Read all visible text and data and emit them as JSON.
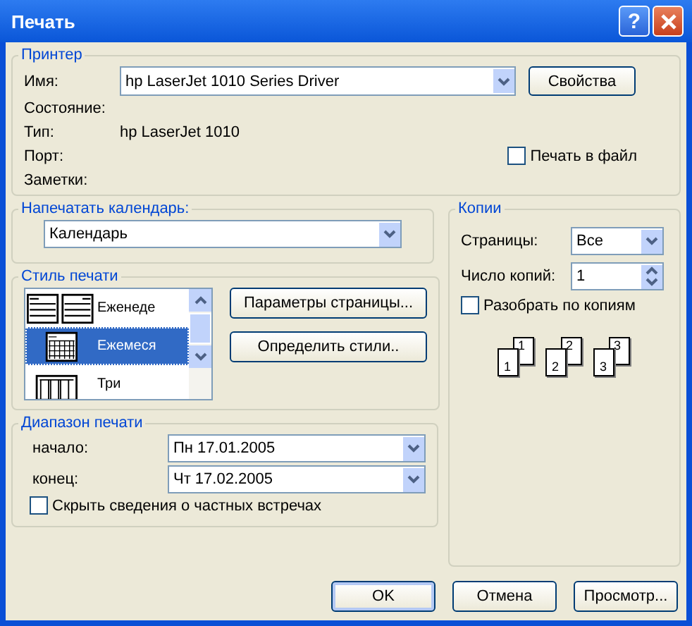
{
  "window": {
    "title": "Печать",
    "help": "?"
  },
  "printer": {
    "legend": "Принтер",
    "name_label": "Имя:",
    "name_value": "hp LaserJet 1010 Series Driver",
    "properties_button": "Свойства",
    "status_label": "Состояние:",
    "type_label": "Тип:",
    "type_value": "hp LaserJet 1010",
    "port_label": "Порт:",
    "notes_label": "Заметки:",
    "print_to_file": {
      "label": "Печать в файл",
      "checked": false
    }
  },
  "calendar": {
    "legend": "Напечатать календарь:",
    "value": "Календарь"
  },
  "print_style": {
    "legend": "Стиль печати",
    "items": [
      {
        "kind": "weekly",
        "label": "Еженеде",
        "selected": false
      },
      {
        "kind": "monthly",
        "label": "Ежемеся",
        "selected": true
      },
      {
        "kind": "trifold",
        "label": "Три",
        "selected": false
      }
    ],
    "buttons": [
      "Параметры страницы...",
      "Определить стили.."
    ]
  },
  "copies": {
    "legend": "Копии",
    "pages_label": "Страницы:",
    "pages_value": "Все",
    "copies_label": "Число копий:",
    "copies_value": "1",
    "collate": {
      "label": "Разобрать по копиям",
      "checked": false
    },
    "collate_numbers": [
      [
        "1",
        "1"
      ],
      [
        "2",
        "2"
      ],
      [
        "3",
        "3"
      ]
    ]
  },
  "range": {
    "legend": "Диапазон печати",
    "start_label": "начало:",
    "start_value": "Пн 17.01.2005",
    "end_label": "конец:",
    "end_value": "Чт 17.02.2005",
    "hide_private": {
      "label": "Скрыть сведения о частных встречах",
      "checked": false
    }
  },
  "buttons": [
    {
      "label": "OK",
      "default": true
    },
    {
      "label": "Отмена",
      "default": false
    },
    {
      "label": "Просмотр...",
      "default": false
    }
  ]
}
